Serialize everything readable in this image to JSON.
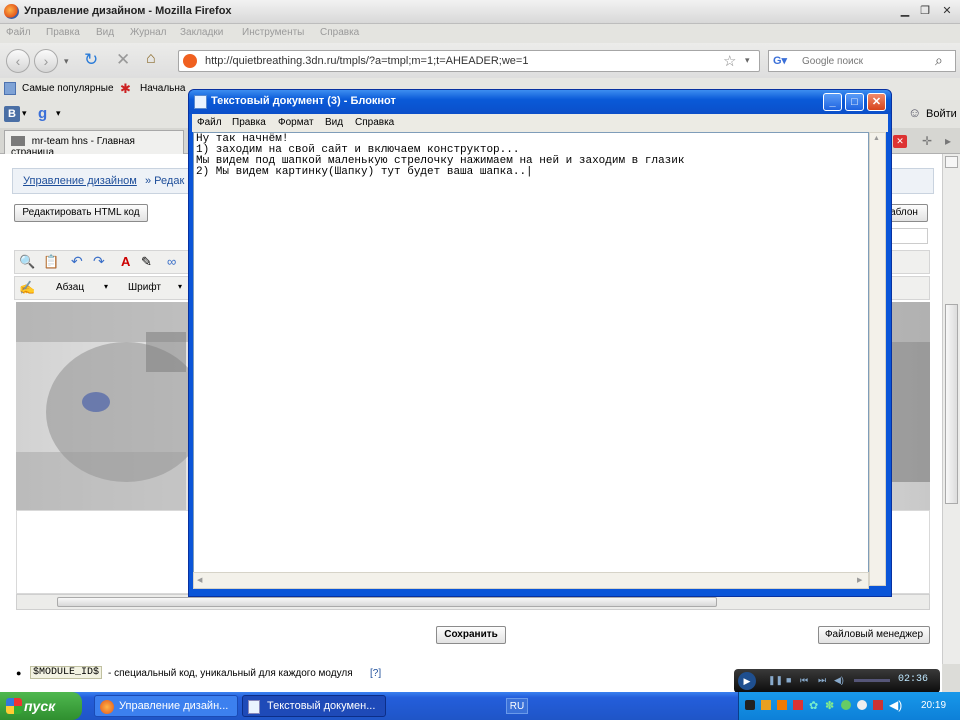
{
  "browser": {
    "title": "Управление дизайном - Mozilla Firefox",
    "menu": [
      "Файл",
      "Правка",
      "Вид",
      "Журнал",
      "Закладки",
      "Инструменты",
      "Справка"
    ],
    "url": "http://quietbreathing.3dn.ru/tmpls/?a=tmpl;m=1;t=AHEADER;we=1",
    "search_placeholder": "Google поиск",
    "bookmarks": [
      "Самые популярные",
      "Начальна"
    ],
    "login": "Войти",
    "tab_label": "mr-team hns - Главная страница"
  },
  "page": {
    "breadcrumb_link": "Управление дизайном",
    "breadcrumb_rest": "» Редак",
    "edit_html_button": "Редактировать HTML код",
    "template_button": "аблон",
    "format_dropdown": "Абзац",
    "font_dropdown": "Шрифт",
    "save_button": "Сохранить",
    "file_manager_button": "Файловый менеджер",
    "module_code": "$MODULE_ID$",
    "module_desc": "- специальный код, уникальный для каждого модуля",
    "module_help": "[?]"
  },
  "notepad": {
    "title": "Текстовый документ (3) - Блокнот",
    "menu": [
      "Файл",
      "Правка",
      "Формат",
      "Вид",
      "Справка"
    ],
    "lines": [
      "Ну так начнём!",
      "1) заходим на свой сайт и включаем конструктор...",
      "Мы видем под шапкой маленькую стрелочку нажимаем на ней и заходим в глазик",
      "2) Мы видем картинку(Шапку) тут будет ваша шапка..|"
    ]
  },
  "player": {
    "time": "02:36"
  },
  "taskbar": {
    "start": "пуск",
    "tasks": [
      "Управление дизайн...",
      "Текстовый докумен..."
    ],
    "lang": "RU",
    "clock": "20:19"
  },
  "colors": {
    "xp_blue": "#245edb",
    "start_green": "#3c9c3c",
    "link_blue": "#1e4e9a"
  }
}
